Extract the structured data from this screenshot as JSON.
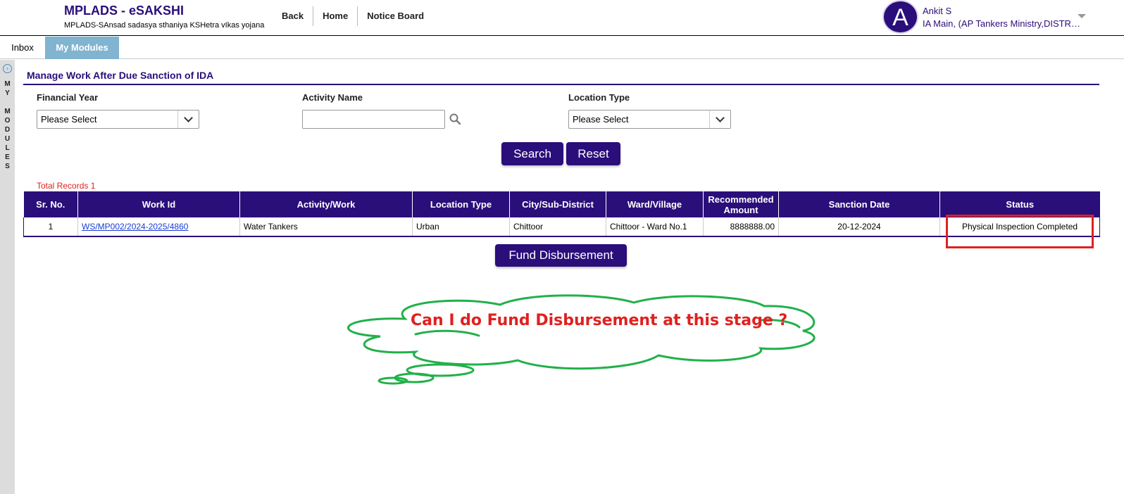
{
  "header": {
    "title": "MPLADS - eSAKSHI",
    "subtitle": "MPLADS-SAnsad sadasya sthaniya KSHetra vIkas yojana",
    "nav": [
      "Back",
      "Home",
      "Notice Board"
    ],
    "user": {
      "initial": "A",
      "name": "Ankit S",
      "role": "IA Main, (AP Tankers Ministry,DISTRICT"
    }
  },
  "tabs": {
    "inbox": "Inbox",
    "my_modules": "My Modules"
  },
  "leftbar": {
    "label_lines": [
      "M",
      "Y",
      "",
      "M",
      "O",
      "D",
      "U",
      "L",
      "E",
      "S"
    ]
  },
  "page": {
    "section_title": "Manage Work After Due Sanction of IDA",
    "filters": {
      "financial_year_label": "Financial Year",
      "financial_year_value": "Please Select",
      "activity_name_label": "Activity Name",
      "activity_name_value": "",
      "location_type_label": "Location Type",
      "location_type_value": "Please Select"
    },
    "buttons": {
      "search": "Search",
      "reset": "Reset",
      "fund_disbursement": "Fund Disbursement"
    },
    "total_records": "Total Records 1",
    "table": {
      "headers": [
        "Sr. No.",
        "Work Id",
        "Activity/Work",
        "Location Type",
        "City/Sub-District",
        "Ward/Village",
        "Recommended Amount",
        "Sanction Date",
        "Status"
      ],
      "rows": [
        {
          "sr_no": "1",
          "work_id": "WS/MP002/2024-2025/4860",
          "activity": "Water Tankers",
          "location_type": "Urban",
          "city": "Chittoor",
          "ward": "Chittoor - Ward No.1",
          "amount": "8888888.00",
          "sanction_date": "20-12-2024",
          "status": "Physical Inspection Completed"
        }
      ]
    },
    "annotation": "Can I do Fund Disbursement at this stage ?"
  },
  "colors": {
    "brand": "#2a0e7a",
    "tab_active": "#80b4d0",
    "highlight": "#e02020",
    "cloud": "#22b04a"
  }
}
